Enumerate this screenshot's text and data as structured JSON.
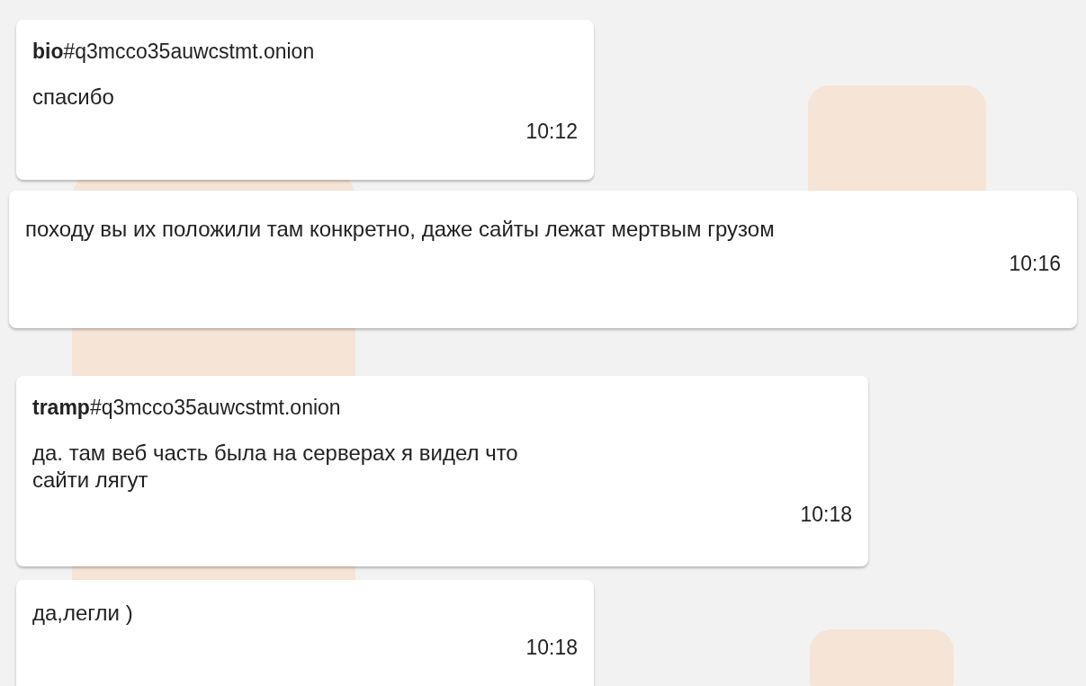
{
  "messages": [
    {
      "sender": "**bio**#q3mcco35auwcstmt.onion",
      "text": "спасибо",
      "time": "10:12"
    },
    {
      "text": "походу вы их положили там конкретно, даже сайты лежат мертвым грузом",
      "time": "10:16"
    },
    {
      "sender": "**tramp**#q3mcco35auwcstmt.onion",
      "text": "да. там веб часть была на серверах я видел что сайти лягут",
      "time": "10:18"
    },
    {
      "text": "да,легли )",
      "time": "10:18"
    }
  ]
}
